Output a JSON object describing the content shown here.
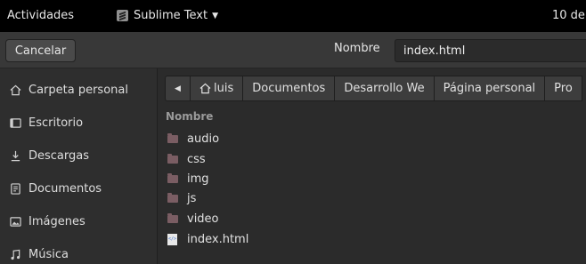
{
  "topbar": {
    "activities": "Actividades",
    "app_name": "Sublime Text",
    "app_menu_caret": "▼",
    "clock": "10 de"
  },
  "header": {
    "cancel_label": "Cancelar",
    "name_label": "Nombre",
    "filename": "index.html"
  },
  "sidebar": {
    "items": [
      {
        "label": "Carpeta personal",
        "icon": "home-icon"
      },
      {
        "label": "Escritorio",
        "icon": "desktop-icon"
      },
      {
        "label": "Descargas",
        "icon": "download-icon"
      },
      {
        "label": "Documentos",
        "icon": "document-icon"
      },
      {
        "label": "Imágenes",
        "icon": "image-icon"
      },
      {
        "label": "Música",
        "icon": "music-icon"
      }
    ]
  },
  "pathbar": {
    "back_arrow": "◀",
    "segments": [
      "luis",
      "Documentos",
      "Desarrollo We",
      "Página personal",
      "Pro"
    ]
  },
  "filelist": {
    "column_header": "Nombre",
    "items": [
      {
        "name": "audio",
        "type": "folder"
      },
      {
        "name": "css",
        "type": "folder"
      },
      {
        "name": "img",
        "type": "folder"
      },
      {
        "name": "js",
        "type": "folder"
      },
      {
        "name": "video",
        "type": "folder"
      },
      {
        "name": "index.html",
        "type": "html-file"
      }
    ]
  },
  "colors": {
    "topbar": "#000000",
    "headerbar": "#383838",
    "sidebar": "#2e2e2e",
    "background": "#2b2b2b",
    "folder": "#7a5d63"
  }
}
